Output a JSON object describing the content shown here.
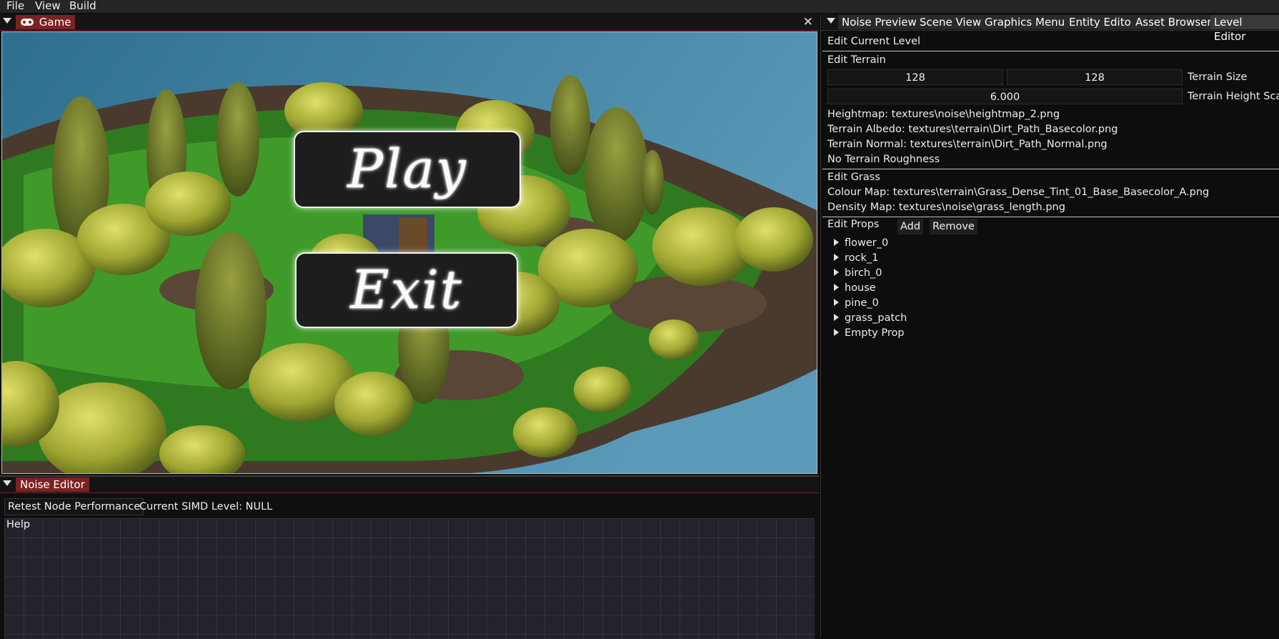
{
  "menubar": {
    "file": "File",
    "view": "View",
    "build": "Build"
  },
  "game": {
    "tab_label": "Game",
    "play_label": "Play",
    "exit_label": "Exit"
  },
  "noise_editor": {
    "tab_label": "Noise Editor",
    "retest_button": "Retest Node Performance",
    "simd_label": "Current SIMD Level: NULL",
    "help_label": "Help"
  },
  "right_tabs": [
    "Noise Preview",
    "Scene View",
    "Graphics Menu",
    "Entity Editor",
    "Asset Browser",
    "Level Editor"
  ],
  "level_editor": {
    "edit_current_level": "Edit Current Level",
    "edit_terrain": "Edit Terrain",
    "terrain_size_x": "128",
    "terrain_size_y": "128",
    "terrain_size_label": "Terrain Size",
    "terrain_height_scale": "6.000",
    "terrain_height_scale_label": "Terrain Height Scale",
    "heightmap": "Heightmap: textures\\noise\\heightmap_2.png",
    "terrain_albedo": "Terrain Albedo: textures\\terrain\\Dirt_Path_Basecolor.png",
    "terrain_normal": "Terrain Normal: textures\\terrain\\Dirt_Path_Normal.png",
    "terrain_roughness": "No Terrain Roughness",
    "edit_grass": "Edit Grass",
    "colour_map": "Colour Map: textures\\terrain\\Grass_Dense_Tint_01_Base_Basecolor_A.png",
    "density_map": "Density Map: textures\\noise\\grass_length.png",
    "edit_props": "Edit Props",
    "add_button": "Add",
    "remove_button": "Remove",
    "props": [
      "flower_0",
      "rock_1",
      "birch_0",
      "house",
      "pine_0",
      "grass_patch",
      "Empty Prop"
    ]
  },
  "colors": {
    "accent_tab": "#7c2222",
    "sky": "#3f7f9f",
    "grass": "#3b8a2a",
    "foliage": "#b9c03a"
  }
}
